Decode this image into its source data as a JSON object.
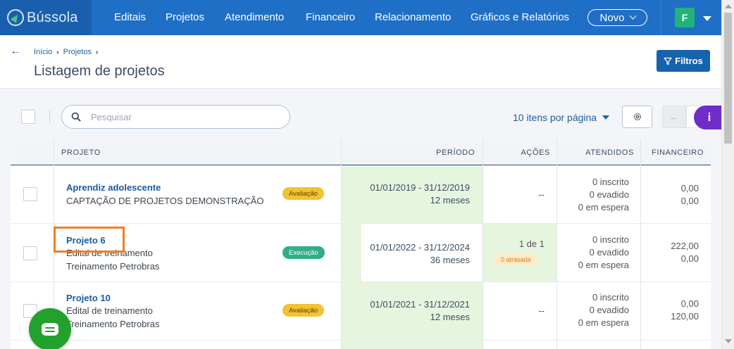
{
  "app": {
    "logo_text": "Bússola"
  },
  "nav": {
    "items": [
      "Editais",
      "Projetos",
      "Atendimento",
      "Financeiro",
      "Relacionamento",
      "Gráficos e Relatórios"
    ],
    "novo_label": "Novo",
    "avatar_initial": "F"
  },
  "breadcrumb": {
    "home": "Início",
    "current": "Projetos"
  },
  "page": {
    "title": "Listagem de projetos",
    "filters_label": "Filtros"
  },
  "toolbar": {
    "search_placeholder": "Pesquisar",
    "per_page_label": "10 itens por página",
    "prev_arrow": "←"
  },
  "info_button": "i",
  "table": {
    "headers": {
      "projeto": "PROJETO",
      "periodo": "PERÍODO",
      "acoes": "AÇÕES",
      "atendidos": "ATENDIDOS",
      "financeiro": "FINANCEIRO"
    },
    "rows": [
      {
        "title": "Aprendiz adolescente",
        "subtitle_1": "CAPTAÇÃO DE PROJETOS DEMONSTRAÇÃO",
        "subtitle_2": "",
        "status": "Avaliação",
        "period_dates": "01/01/2019 - 31/12/2019",
        "period_months": "12 meses",
        "actions": "--",
        "actions_late": "",
        "atendidos": {
          "inscrito": "0 inscrito",
          "evadido": "0 evadido",
          "espera": "0 em espera"
        },
        "financeiro": {
          "value_1": "0,00",
          "value_2": "0,00"
        }
      },
      {
        "title": "Projeto 6",
        "subtitle_1": "Edital de treinamento",
        "subtitle_2": "Treinamento Petrobras",
        "status": "Execução",
        "period_dates": "01/01/2022 - 31/12/2024",
        "period_months": "36 meses",
        "actions": "1 de 1",
        "actions_late": "0 atrasada",
        "atendidos": {
          "inscrito": "0 inscrito",
          "evadido": "0 evadido",
          "espera": "0 em espera"
        },
        "financeiro": {
          "value_1": "222,00",
          "value_2": "0,00"
        }
      },
      {
        "title": "Projeto 10",
        "subtitle_1": "Edital de treinamento",
        "subtitle_2": "Treinamento Petrobras",
        "status": "Avaliação",
        "period_dates": "01/01/2021 - 31/12/2021",
        "period_months": "12 meses",
        "actions": "--",
        "actions_late": "",
        "atendidos": {
          "inscrito": "0 inscrito",
          "evadido": "0 evadido",
          "espera": "0 em espera"
        },
        "financeiro": {
          "value_1": "0,00",
          "value_2": "120,00"
        }
      }
    ]
  },
  "colors": {
    "nav_bg": "#1f6fc6",
    "primary": "#1762ad",
    "success": "#2fae87",
    "warning": "#f2c233",
    "info": "#6f2cc8",
    "period_bg": "#e6f6de",
    "highlight": "#f47d20",
    "chat": "#22a22c"
  }
}
